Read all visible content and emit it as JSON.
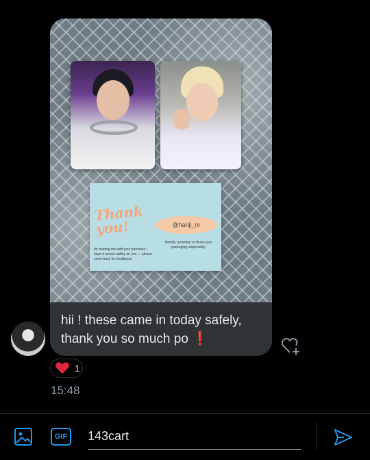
{
  "message": {
    "text_line1": "hii ! these came in today safely,",
    "text_line2": "thank you so much po",
    "emoji": "❗"
  },
  "photo": {
    "thanks_card": {
      "title": "Thank you!",
      "handle": "@hanji_nr",
      "fine_print_left": "for trusting me with your purchase I hope it arrives safely on you — please come back for feedbacks",
      "fine_print_right": "friendly reminder! to throw your packaging responsibly"
    }
  },
  "reaction": {
    "emoji_name": "heart-icon",
    "count": "1"
  },
  "timestamp": "15:48",
  "composer": {
    "gif_label": "GIF",
    "input_value": "143cart",
    "send_icon": "send-icon",
    "image_icon": "image-icon"
  },
  "colors": {
    "accent": "#1d9bf0",
    "bubble": "#2f3336",
    "heart": "#e0263e",
    "timestamp": "#8b98a5"
  }
}
